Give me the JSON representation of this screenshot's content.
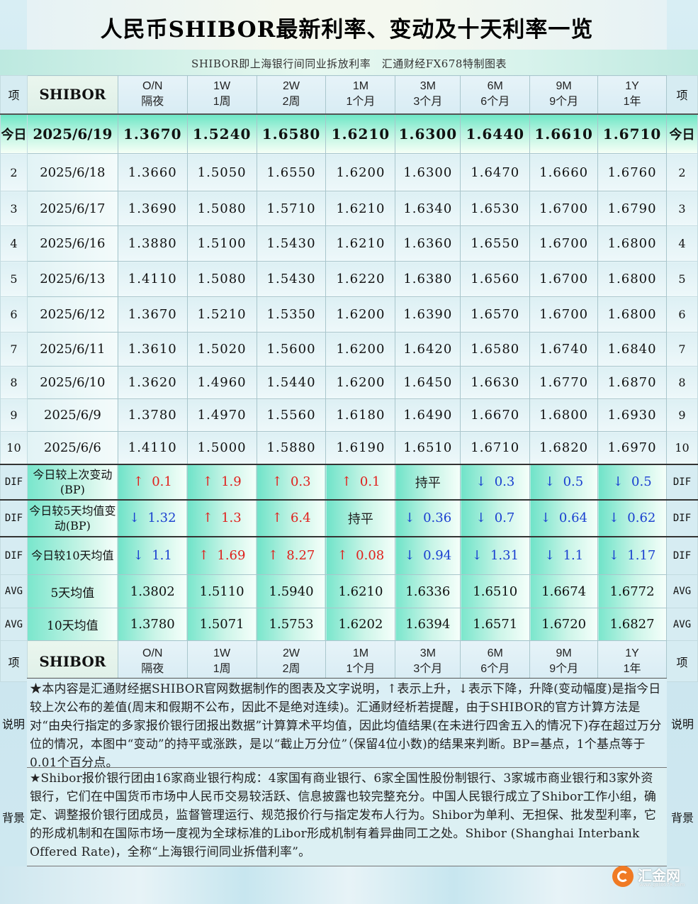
{
  "title": "人民币SHIBOR最新利率、变动及十天利率一览",
  "subtitle": "SHIBOR即上海银行间同业拆放利率　汇通财经FX678特制图表",
  "header": {
    "side_label": "项",
    "name": "SHIBOR",
    "terms": [
      {
        "code": "O/N",
        "cn": "隔夜"
      },
      {
        "code": "1W",
        "cn": "1周"
      },
      {
        "code": "2W",
        "cn": "2周"
      },
      {
        "code": "1M",
        "cn": "1个月"
      },
      {
        "code": "3M",
        "cn": "3个月"
      },
      {
        "code": "6M",
        "cn": "6个月"
      },
      {
        "code": "9M",
        "cn": "9个月"
      },
      {
        "code": "1Y",
        "cn": "1年"
      }
    ]
  },
  "today": {
    "side": "今日",
    "date": "2025/6/19",
    "values": [
      "1.3670",
      "1.5240",
      "1.6580",
      "1.6210",
      "1.6300",
      "1.6440",
      "1.6610",
      "1.6710"
    ]
  },
  "history": [
    {
      "idx": "2",
      "date": "2025/6/18",
      "values": [
        "1.3660",
        "1.5050",
        "1.6550",
        "1.6200",
        "1.6300",
        "1.6470",
        "1.6660",
        "1.6760"
      ]
    },
    {
      "idx": "3",
      "date": "2025/6/17",
      "values": [
        "1.3690",
        "1.5080",
        "1.5710",
        "1.6210",
        "1.6340",
        "1.6530",
        "1.6700",
        "1.6790"
      ]
    },
    {
      "idx": "4",
      "date": "2025/6/16",
      "values": [
        "1.3880",
        "1.5100",
        "1.5430",
        "1.6210",
        "1.6360",
        "1.6550",
        "1.6700",
        "1.6800"
      ]
    },
    {
      "idx": "5",
      "date": "2025/6/13",
      "values": [
        "1.4110",
        "1.5080",
        "1.5430",
        "1.6220",
        "1.6380",
        "1.6560",
        "1.6700",
        "1.6800"
      ]
    },
    {
      "idx": "6",
      "date": "2025/6/12",
      "values": [
        "1.3670",
        "1.5210",
        "1.5350",
        "1.6200",
        "1.6390",
        "1.6570",
        "1.6700",
        "1.6800"
      ]
    },
    {
      "idx": "7",
      "date": "2025/6/11",
      "values": [
        "1.3610",
        "1.5020",
        "1.5600",
        "1.6200",
        "1.6420",
        "1.6580",
        "1.6740",
        "1.6840"
      ]
    },
    {
      "idx": "8",
      "date": "2025/6/10",
      "values": [
        "1.3620",
        "1.4960",
        "1.5440",
        "1.6200",
        "1.6450",
        "1.6630",
        "1.6770",
        "1.6870"
      ]
    },
    {
      "idx": "9",
      "date": "2025/6/9",
      "values": [
        "1.3780",
        "1.4970",
        "1.5560",
        "1.6180",
        "1.6490",
        "1.6670",
        "1.6800",
        "1.6930"
      ]
    },
    {
      "idx": "10",
      "date": "2025/6/6",
      "values": [
        "1.4110",
        "1.5000",
        "1.5880",
        "1.6190",
        "1.6510",
        "1.6710",
        "1.6820",
        "1.6970"
      ]
    }
  ],
  "dif_rows": [
    {
      "side": "DIF",
      "label": "今日较上次变动(BP)",
      "cells": [
        {
          "dir": "up",
          "arrow": "↑",
          "value": "0.1"
        },
        {
          "dir": "up",
          "arrow": "↑",
          "value": "1.9"
        },
        {
          "dir": "up",
          "arrow": "↑",
          "value": "0.3"
        },
        {
          "dir": "up",
          "arrow": "↑",
          "value": "0.1"
        },
        {
          "dir": "flat",
          "arrow": "",
          "value": "持平"
        },
        {
          "dir": "down",
          "arrow": "↓",
          "value": "0.3"
        },
        {
          "dir": "down",
          "arrow": "↓",
          "value": "0.5"
        },
        {
          "dir": "down",
          "arrow": "↓",
          "value": "0.5"
        }
      ]
    },
    {
      "side": "DIF",
      "label": "今日较5天均值变动(BP)",
      "cells": [
        {
          "dir": "down",
          "arrow": "↓",
          "value": "1.32"
        },
        {
          "dir": "up",
          "arrow": "↑",
          "value": "1.3"
        },
        {
          "dir": "up",
          "arrow": "↑",
          "value": "6.4"
        },
        {
          "dir": "flat",
          "arrow": "",
          "value": "持平"
        },
        {
          "dir": "down",
          "arrow": "↓",
          "value": "0.36"
        },
        {
          "dir": "down",
          "arrow": "↓",
          "value": "0.7"
        },
        {
          "dir": "down",
          "arrow": "↓",
          "value": "0.64"
        },
        {
          "dir": "down",
          "arrow": "↓",
          "value": "0.62"
        }
      ]
    },
    {
      "side": "DIF",
      "label": "今日较10天均值",
      "cells": [
        {
          "dir": "down",
          "arrow": "↓",
          "value": "1.1"
        },
        {
          "dir": "up",
          "arrow": "↑",
          "value": "1.69"
        },
        {
          "dir": "up",
          "arrow": "↑",
          "value": "8.27"
        },
        {
          "dir": "up",
          "arrow": "↑",
          "value": "0.08"
        },
        {
          "dir": "down",
          "arrow": "↓",
          "value": "0.94"
        },
        {
          "dir": "down",
          "arrow": "↓",
          "value": "1.31"
        },
        {
          "dir": "down",
          "arrow": "↓",
          "value": "1.1"
        },
        {
          "dir": "down",
          "arrow": "↓",
          "value": "1.17"
        }
      ]
    }
  ],
  "avg_rows": [
    {
      "side": "AVG",
      "label": "5天均值",
      "values": [
        "1.3802",
        "1.5110",
        "1.5940",
        "1.6210",
        "1.6336",
        "1.6510",
        "1.6674",
        "1.6772"
      ]
    },
    {
      "side": "AVG",
      "label": "10天均值",
      "values": [
        "1.3780",
        "1.5071",
        "1.5753",
        "1.6202",
        "1.6394",
        "1.6571",
        "1.6720",
        "1.6827"
      ]
    }
  ],
  "notes": [
    {
      "side": "说明",
      "text": "★本内容是汇通财经据SHIBOR官网数据制作的图表及文字说明，↑表示上升，↓表示下降，升降(变动幅度)是指今日较上次公布的差值(周末和假期不公布，因此不是绝对连续)。汇通财经析若提醒，由于SHIBOR的官方计算方法是对“由央行指定的多家报价银行团报出数据”计算算术平均值，因此均值结果(在未进行四舍五入的情况下)存在超过万分位的情况，本图中“变动”的持平或涨跌，是以“截止万分位”（保留4位小数)的结果来判断。BP=基点，1个基点等于0.01个百分点。"
    },
    {
      "side": "背景",
      "text": "★Shibor报价银行团由16家商业银行构成：4家国有商业银行、6家全国性股份制银行、3家城市商业银行和3家外资银行，它们在中国货币市场中人民币交易较活跃、信息披露也较完整充分。中国人民银行成立了Shibor工作小组，确定、调整报价银行团成员，监督管理运行、规范报价行与指定发布人行为。Shibor为单利、无担保、批发型利率，它的形成机制和在国际市场一度视为全球标准的Libor形成机制有着异曲同工之处。Shibor (Shanghai Interbank Offered Rate)，全称“上海银行间同业拆借利率”。"
    }
  ],
  "logo": {
    "text": "汇金网",
    "url": "www.gold678.com",
    "color": "#f07a24"
  },
  "colors": {
    "up": "#e0201c",
    "down": "#1a3fd0",
    "accent": "#6fe7c6"
  }
}
